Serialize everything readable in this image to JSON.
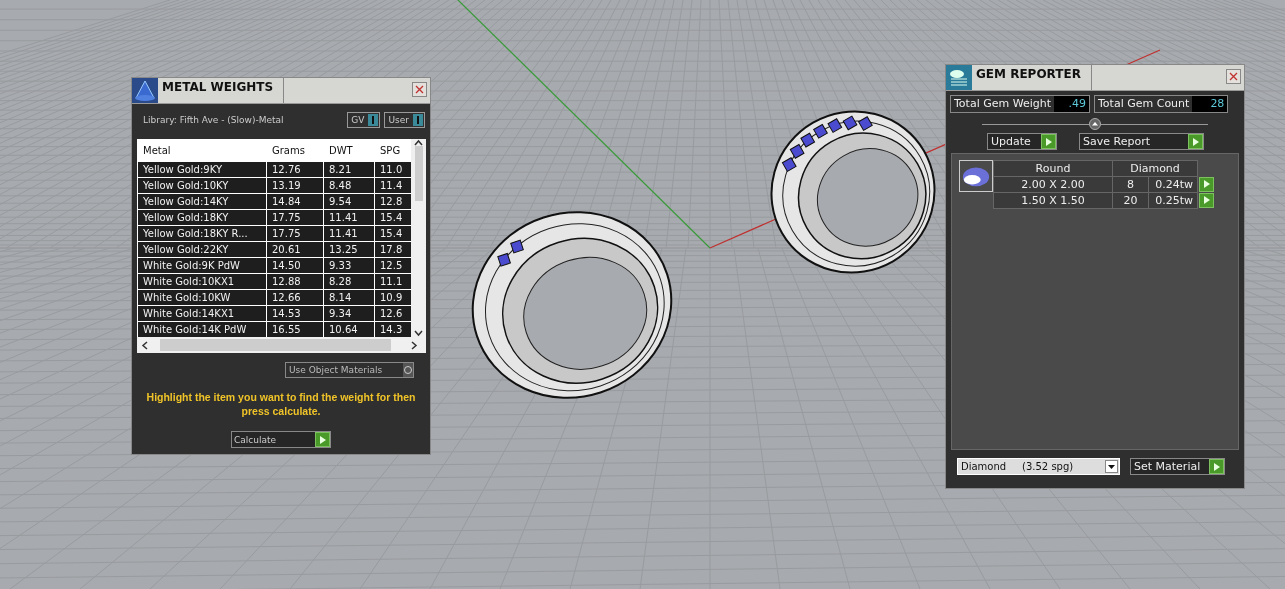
{
  "metal_weights": {
    "title": "METAL WEIGHTS",
    "library": "Library: Fifth Ave - (Slow)-Metal",
    "toggles": [
      {
        "label": "GV",
        "on": true
      },
      {
        "label": "User",
        "on": true
      }
    ],
    "table": {
      "columns": [
        "Metal",
        "Grams",
        "DWT",
        "SPG"
      ],
      "rows": [
        [
          "Yellow Gold:9KY",
          "12.76",
          "8.21",
          "11.0"
        ],
        [
          "Yellow Gold:10KY",
          "13.19",
          "8.48",
          "11.4"
        ],
        [
          "Yellow Gold:14KY",
          "14.84",
          "9.54",
          "12.8"
        ],
        [
          "Yellow Gold:18KY",
          "17.75",
          "11.41",
          "15.4"
        ],
        [
          "Yellow Gold:18KY R...",
          "17.75",
          "11.41",
          "15.4"
        ],
        [
          "Yellow Gold:22KY",
          "20.61",
          "13.25",
          "17.8"
        ],
        [
          "White Gold:9K PdW",
          "14.50",
          "9.33",
          "12.5"
        ],
        [
          "White Gold:10KX1",
          "12.88",
          "8.28",
          "11.1"
        ],
        [
          "White Gold:10KW",
          "12.66",
          "8.14",
          "10.9"
        ],
        [
          "White Gold:14KX1",
          "14.53",
          "9.34",
          "12.6"
        ],
        [
          "White Gold:14K PdW",
          "16.55",
          "10.64",
          "14.3"
        ]
      ]
    },
    "use_object_materials": {
      "label": "Use Object Materials",
      "on": false
    },
    "hint": "Highlight the item you want to find the weight for then press calculate.",
    "calculate_button": "Calculate"
  },
  "gem_reporter": {
    "title": "GEM REPORTER",
    "totals": [
      {
        "label": "Total Gem Weight",
        "value": ".49"
      },
      {
        "label": "Total Gem Count",
        "value": "28"
      }
    ],
    "buttons": [
      "Update",
      "Save Report"
    ],
    "table": {
      "shape": "Round",
      "material": "Diamond",
      "rows": [
        [
          "2.00 X 2.00",
          "8",
          "0.24tw"
        ],
        [
          "1.50 X 1.50",
          "20",
          "0.25tw"
        ]
      ]
    },
    "material_dropdown": "Diamond     (3.52 spg)",
    "set_material_button": "Set Material"
  }
}
